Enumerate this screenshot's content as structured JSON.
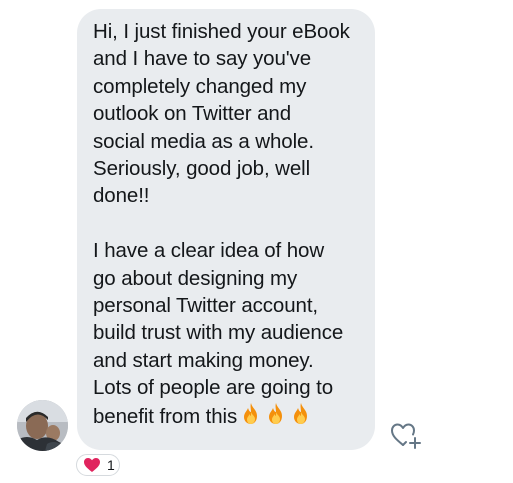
{
  "message": {
    "text": "Hi, I just finished your eBook\nand I have to say you've\ncompletely changed my\noutlook on Twitter and\nsocial media as a whole.\nSeriously, good job, well\ndone!!\n\nI have a clear idea of how\ngo about designing my\npersonal Twitter account,\nbuild trust with my audience\nand start making money.\nLots of people are going to\nbenefit from this",
    "emoji": [
      "fire-icon",
      "fire-icon",
      "fire-icon"
    ]
  },
  "reaction": {
    "icon": "heart-icon",
    "count": "1"
  },
  "add_reaction": {
    "icon": "heart-plus-icon"
  },
  "colors": {
    "bubble": "#e9ecef",
    "text": "#14171a",
    "heart": "#e0245e",
    "icon_stroke": "#657786"
  }
}
